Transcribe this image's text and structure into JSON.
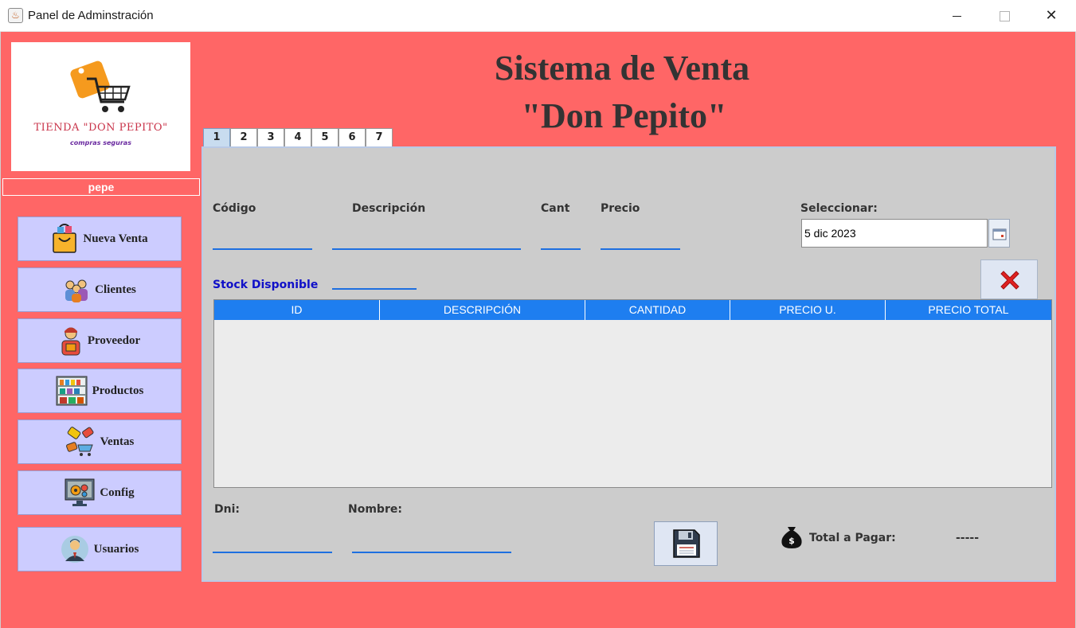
{
  "window": {
    "title": "Panel de Adminstración",
    "close_glyph": "✕"
  },
  "brand": {
    "logo_text": "TIENDA \"DON PEPITO\"",
    "logo_subtext": "compras seguras",
    "logo_icon": "shopping-cart-tag-icon"
  },
  "user": {
    "name": "pepe"
  },
  "sidebar": {
    "items": [
      {
        "label": "Nueva Venta",
        "icon": "shopping-bag-icon"
      },
      {
        "label": "Clientes",
        "icon": "customers-icon"
      },
      {
        "label": "Proveedor",
        "icon": "supplier-icon"
      },
      {
        "label": "Productos",
        "icon": "shelves-icon"
      },
      {
        "label": "Ventas",
        "icon": "sales-tags-icon"
      },
      {
        "label": "Config",
        "icon": "settings-monitor-icon"
      },
      {
        "label": "Usuarios",
        "icon": "user-avatar-icon"
      }
    ]
  },
  "header": {
    "title_line1": "Sistema de Venta",
    "title_line2": "\"Don Pepito\""
  },
  "tabs": [
    "1",
    "2",
    "3",
    "4",
    "5",
    "6",
    "7"
  ],
  "active_tab": "1",
  "form": {
    "codigo_label": "Código",
    "descripcion_label": "Descripción",
    "cant_label": "Cant",
    "precio_label": "Precio",
    "seleccionar_label": "Seleccionar:",
    "date_value": "5 dic 2023",
    "stock_label": "Stock Disponible",
    "dni_label": "Dni:",
    "nombre_label": "Nombre:",
    "total_label": "Total a Pagar:",
    "total_value": "-----"
  },
  "table": {
    "columns": [
      "ID",
      "DESCRIPCIÓN",
      "CANTIDAD",
      "PRECIO U.",
      "PRECIO TOTAL"
    ],
    "rows": []
  },
  "colors": {
    "background": "#ff6666",
    "panel": "#cccccc",
    "nav_button": "#ccccff",
    "table_header": "#1e7ef0",
    "field_underline": "#1e6fe0",
    "stock_label": "#1010c8"
  }
}
